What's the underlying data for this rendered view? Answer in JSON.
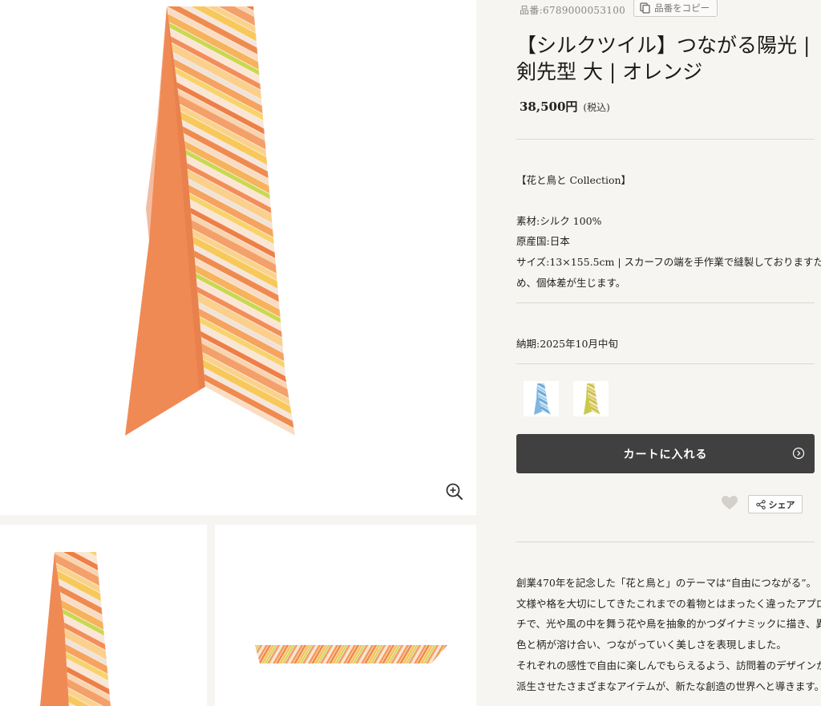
{
  "product": {
    "sku_label": "品番:6789000053100",
    "copy_label": "品番をコピー",
    "title_line1": "【シルクツイル】つながる陽光 |",
    "title_line2": "剣先型 大 | オレンジ",
    "price": "38,500円",
    "tax": "(税込)",
    "collection": "【花と鳥と Collection】",
    "material": "素材:シルク 100%",
    "origin": "原産国:日本",
    "size_line1": "サイズ:13×155.5cm | スカーフの端を手作業で縫製しておりますた",
    "size_line2": "め、個体差が生じます。",
    "delivery": "納期:2025年10月中旬"
  },
  "colors": [
    {
      "name": "blue",
      "accent": "#7fb6df"
    },
    {
      "name": "yellow-green",
      "accent": "#c8c94f"
    }
  ],
  "actions": {
    "cart_label": "カートに入れる",
    "share_label": "シェア"
  },
  "description": [
    "創業470年を記念した「花と鳥と」のテーマは“自由につながる”。",
    "文様や格を大切にしてきたこれまでの着物とはまったく違ったアプロー",
    "チで、光や風の中を舞う花や鳥を抽象的かつダイナミックに描き、異なる",
    "色と柄が溶け合い、つながっていく美しさを表現しました。",
    "それぞれの感性で自由に楽しんでもらえるよう、訪問着のデザインから",
    "派生させたさまざまなアイテムが、新たな創造の世界へと導きます。"
  ],
  "icons": {
    "zoom": "zoom-in-icon",
    "copy": "copy-icon",
    "cart_arrow": "circle-arrow-icon",
    "favorite": "heart-icon",
    "share": "share-icon"
  },
  "palette": {
    "accent_orange": "#f08a4b",
    "cart_bg": "#404040",
    "panel_bg": "#f7f5f1"
  }
}
